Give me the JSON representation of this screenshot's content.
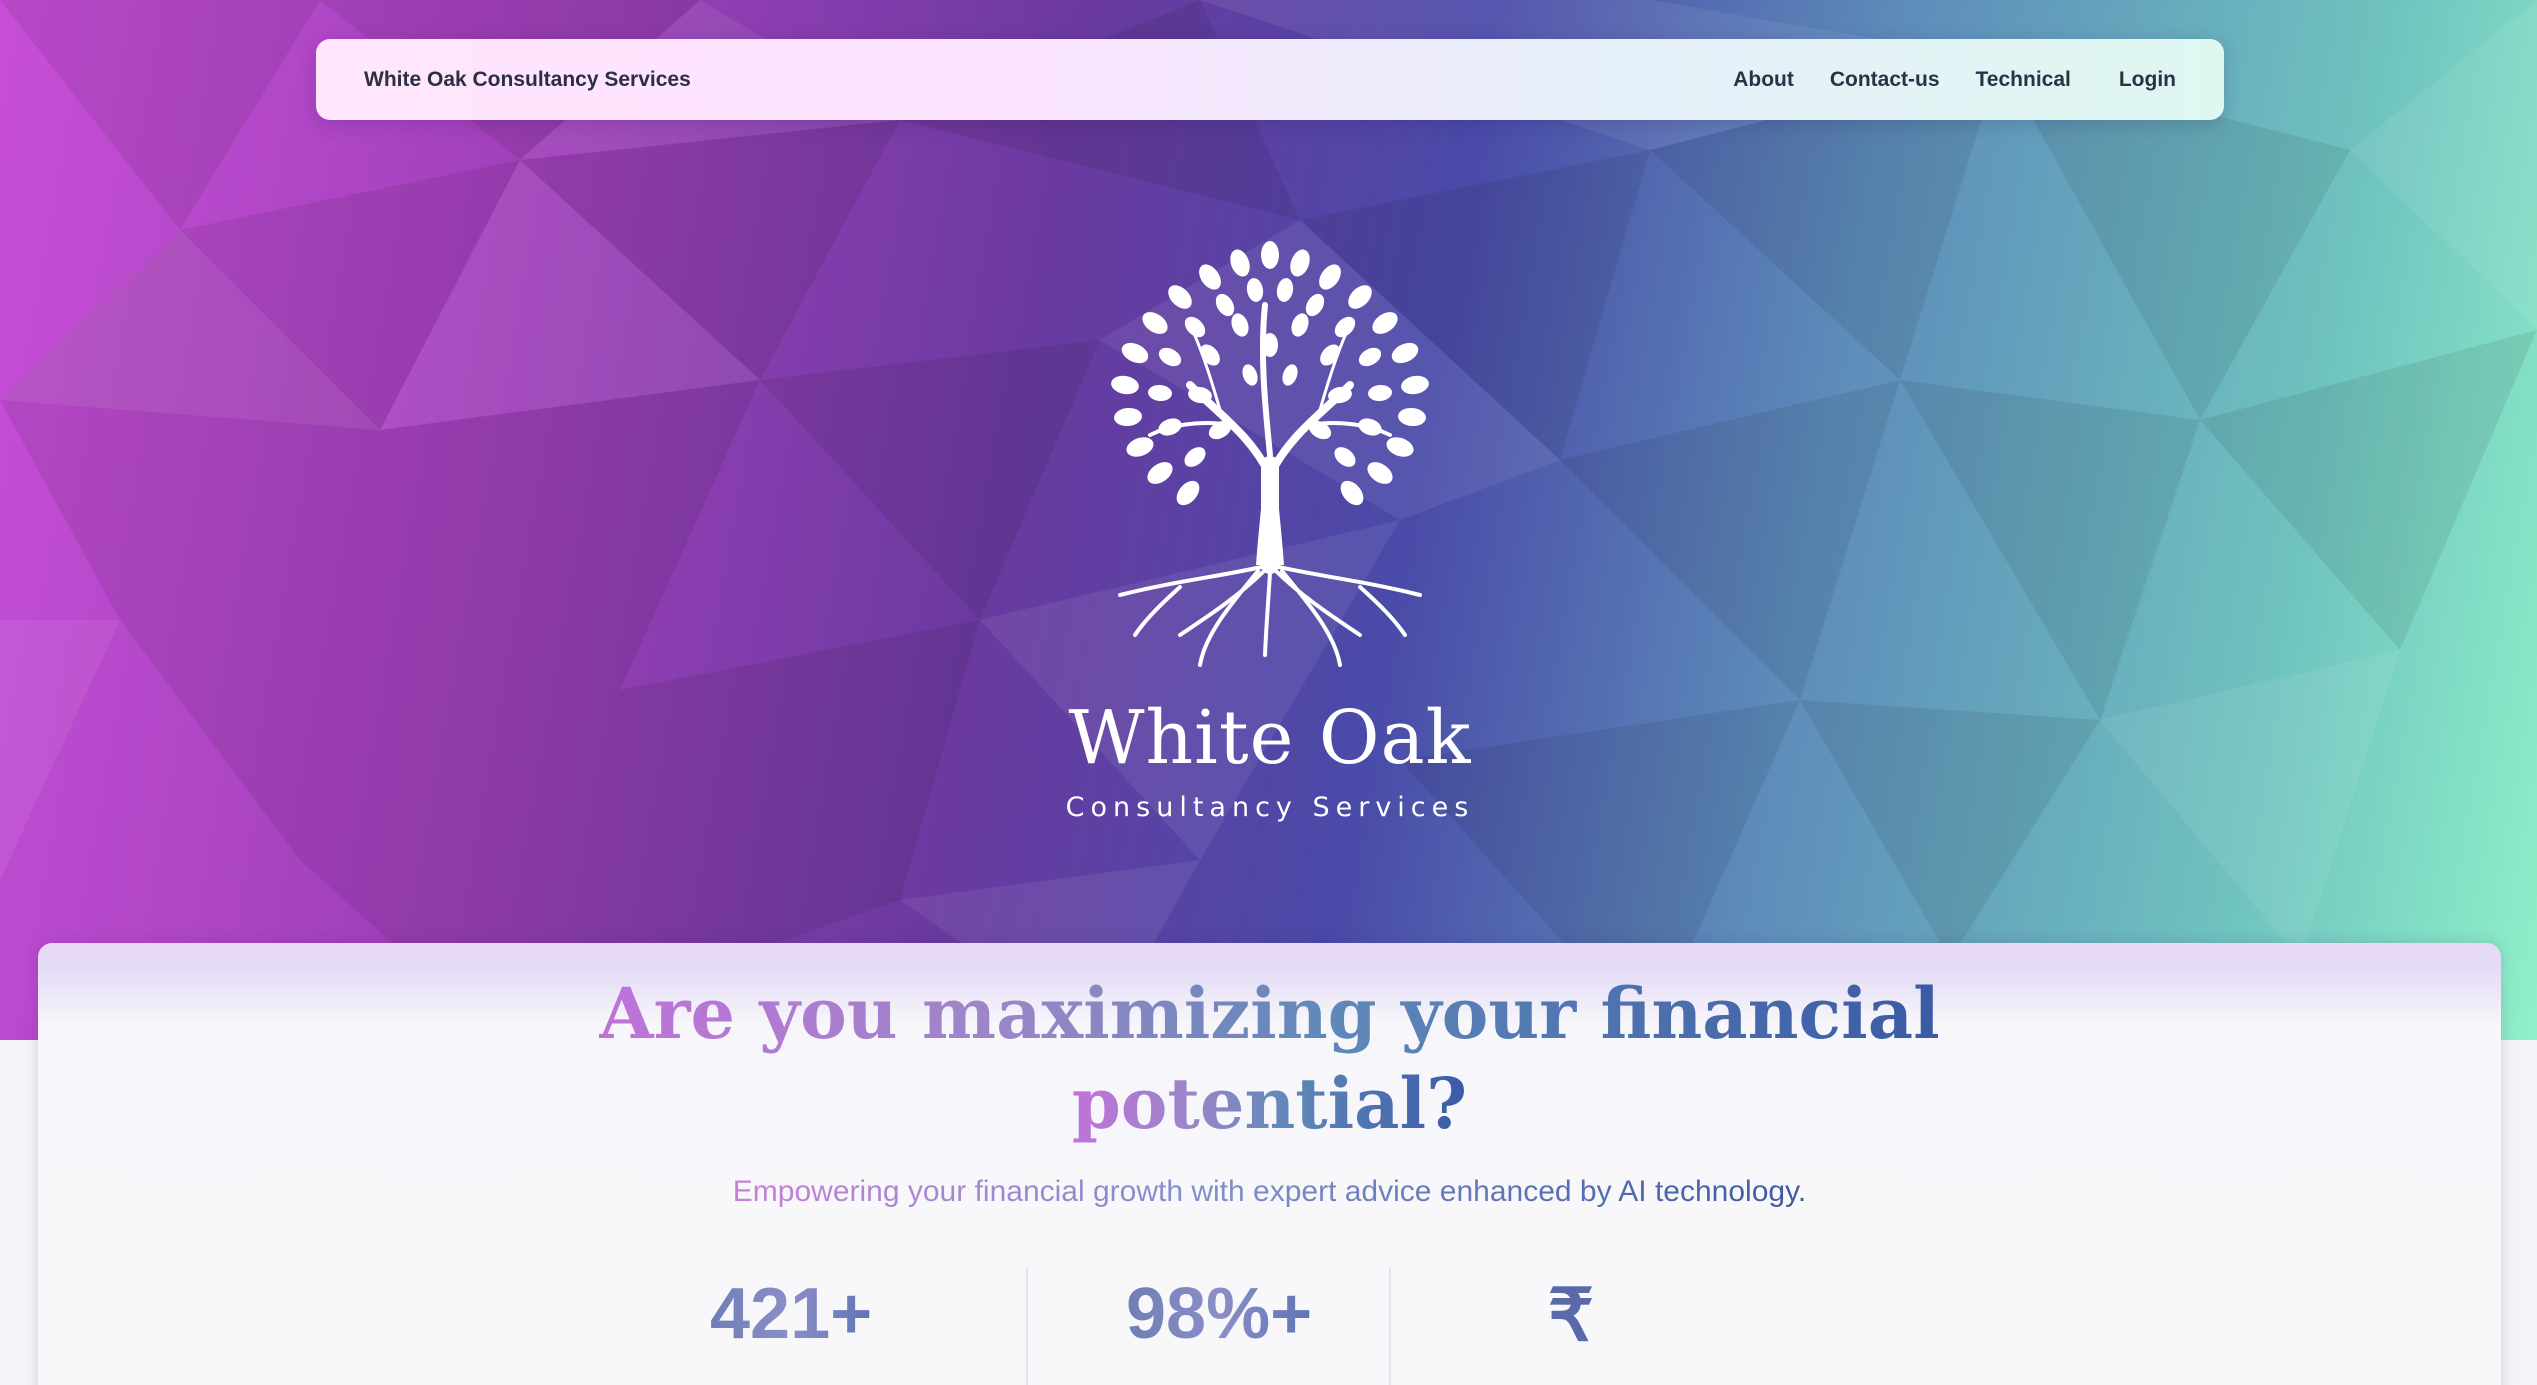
{
  "navbar": {
    "brand": "White Oak Consultancy Services",
    "links": [
      {
        "label": "About"
      },
      {
        "label": "Contact-us"
      },
      {
        "label": "Technical"
      },
      {
        "label": "Login"
      }
    ]
  },
  "hero": {
    "logo_title": "White Oak",
    "logo_subtitle": "Consultancy Services",
    "logo_icon": "oak-tree-icon"
  },
  "main": {
    "headline_line1": "Are you maximizing your financial",
    "headline_line2": "potential?",
    "tagline": "Empowering your financial growth with expert advice enhanced by AI technology.",
    "stats": [
      {
        "value": "421+"
      },
      {
        "value": "98%+"
      },
      {
        "value": "₹"
      }
    ]
  },
  "colors": {
    "hero_left": "#c84fd8",
    "hero_mid": "#4a4aa8",
    "hero_right": "#8ff0c9",
    "nav_text": "#2a3345"
  }
}
